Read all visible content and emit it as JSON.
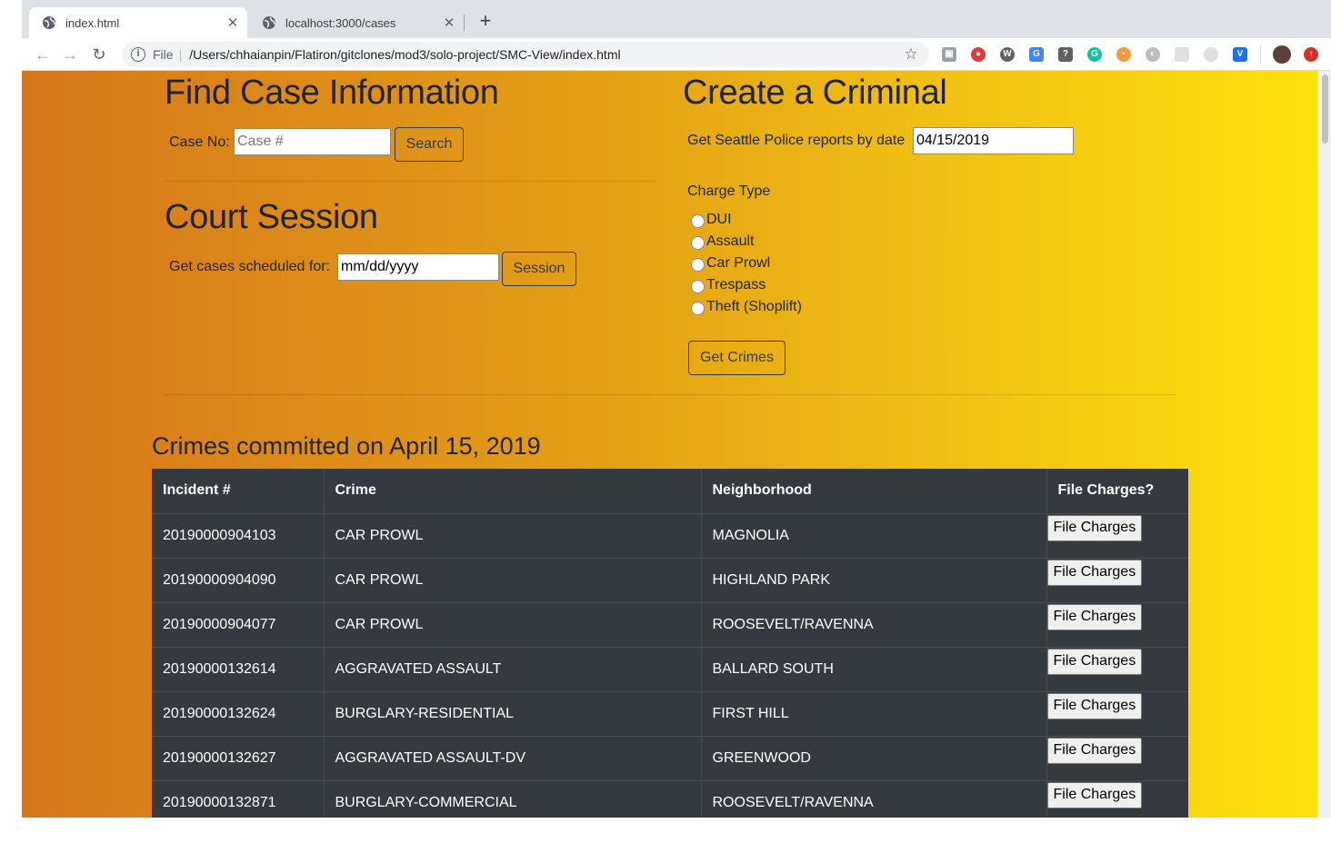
{
  "browser": {
    "tabs": [
      {
        "title": "index.html",
        "active": true
      },
      {
        "title": "localhost:3000/cases",
        "active": false
      }
    ],
    "new_tab": "+",
    "close_glyph": "✕",
    "omnibox": {
      "scheme": "File",
      "url": "/Users/chhaianpin/Flatiron/gitclones/mod3/solo-project/SMC-View/index.html"
    },
    "extensions": [
      "camera-icon",
      "adblock-icon",
      "wordpress-icon",
      "translate-icon",
      "help-icon",
      "grammarly-icon",
      "cookie-icon",
      "incognito-icon",
      "image-icon",
      "clock-icon",
      "vimeo-icon",
      "avatar-icon",
      "update-icon"
    ]
  },
  "find_case": {
    "title": "Find Case Information",
    "case_label": "Case No:",
    "case_placeholder": "Case #",
    "search_label": "Search"
  },
  "court_session": {
    "title": "Court Session",
    "date_label": "Get cases scheduled for:",
    "date_value": "mm/dd/yyyy",
    "session_label": "Session"
  },
  "create_criminal": {
    "title": "Create a Criminal",
    "reports_label": "Get Seattle Police reports by date",
    "reports_date": "04/15/2019",
    "charge_type_label": "Charge Type",
    "charge_types": [
      "DUI",
      "Assault",
      "Car Prowl",
      "Trespass",
      "Theft (Shoplift)"
    ],
    "get_crimes_label": "Get Crimes"
  },
  "crimes": {
    "title": "Crimes committed on April 15, 2019",
    "headers": [
      "Incident #",
      "Crime",
      "Neighborhood",
      "File Charges?"
    ],
    "action_label": "File Charges",
    "rows": [
      {
        "incident": "20190000904103",
        "crime": "CAR PROWL",
        "neighborhood": "MAGNOLIA"
      },
      {
        "incident": "20190000904090",
        "crime": "CAR PROWL",
        "neighborhood": "HIGHLAND PARK"
      },
      {
        "incident": "20190000904077",
        "crime": "CAR PROWL",
        "neighborhood": "ROOSEVELT/RAVENNA"
      },
      {
        "incident": "20190000132614",
        "crime": "AGGRAVATED ASSAULT",
        "neighborhood": "BALLARD SOUTH"
      },
      {
        "incident": "20190000132624",
        "crime": "BURGLARY-RESIDENTIAL",
        "neighborhood": "FIRST HILL"
      },
      {
        "incident": "20190000132627",
        "crime": "AGGRAVATED ASSAULT-DV",
        "neighborhood": "GREENWOOD"
      },
      {
        "incident": "20190000132871",
        "crime": "BURGLARY-COMMERCIAL",
        "neighborhood": "ROOSEVELT/RAVENNA"
      }
    ]
  }
}
